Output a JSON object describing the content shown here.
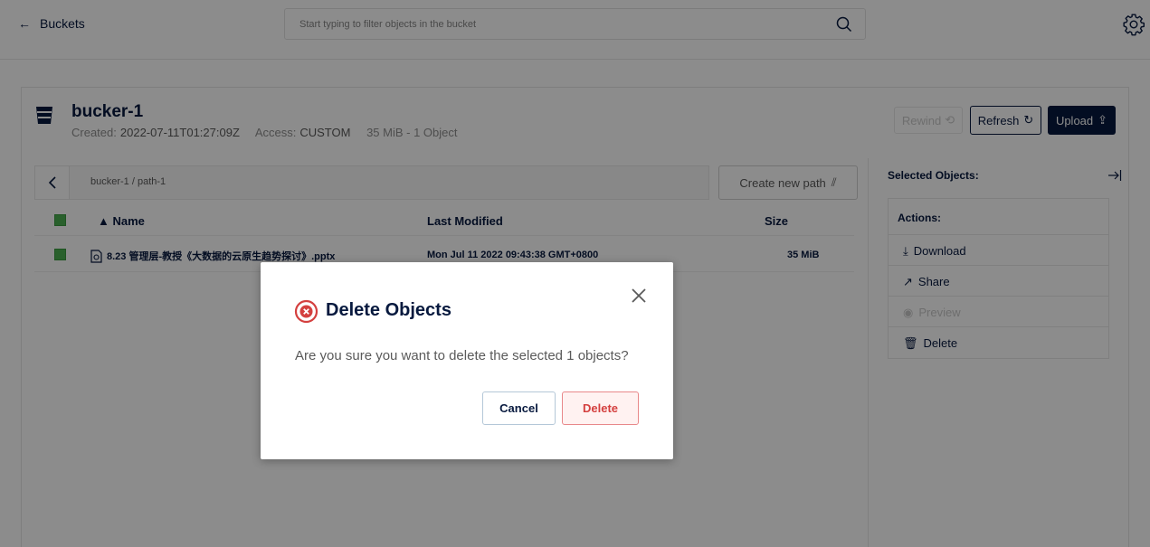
{
  "topbar": {
    "back_label": "Buckets",
    "search_placeholder": "Start typing to filter objects in the bucket"
  },
  "bucket": {
    "name": "bucker-1",
    "created_label": "Created:",
    "created_value": "2022-07-11T01:27:09Z",
    "access_label": "Access:",
    "access_value": "CUSTOM",
    "usage": "35 MiB - 1 Object"
  },
  "toolbar": {
    "rewind_label": "Rewind",
    "refresh_label": "Refresh",
    "upload_label": "Upload"
  },
  "path": {
    "crumbs": "bucker-1 / path-1",
    "create_label": "Create new path"
  },
  "table": {
    "headers": {
      "name": "Name",
      "modified": "Last Modified",
      "size": "Size"
    },
    "rows": [
      {
        "name": "8.23 管理层-教授《大数据的云原生趋势探讨》.pptx",
        "modified": "Mon Jul 11 2022 09:43:38 GMT+0800",
        "size": "35 MiB"
      }
    ]
  },
  "sidebar": {
    "title": "Selected Objects:",
    "actions_label": "Actions:",
    "items": [
      {
        "label": "Download",
        "icon": "download-icon",
        "enabled": true
      },
      {
        "label": "Share",
        "icon": "share-icon",
        "enabled": true
      },
      {
        "label": "Preview",
        "icon": "eye-icon",
        "enabled": false
      },
      {
        "label": "Delete",
        "icon": "trash-icon",
        "enabled": true
      }
    ]
  },
  "dialog": {
    "title": "Delete Objects",
    "message": "Are you sure you want to delete the selected 1 objects?",
    "cancel_label": "Cancel",
    "delete_label": "Delete"
  },
  "colors": {
    "brand": "#07193e",
    "danger": "#d4403f",
    "checkbox": "#4caf50"
  }
}
